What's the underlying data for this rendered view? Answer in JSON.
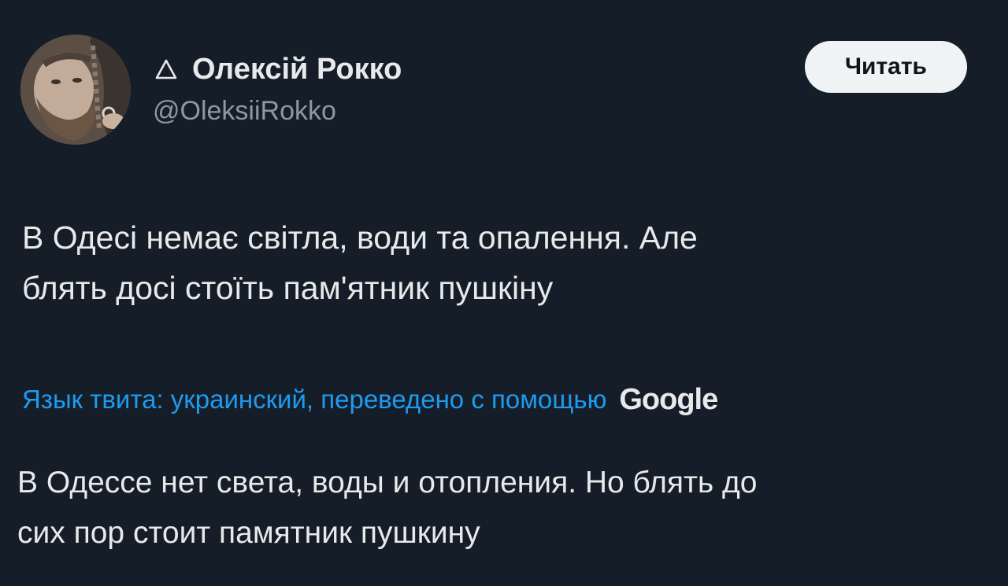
{
  "author": {
    "name": "Олексій Рокко",
    "handle": "@OleksiiRokko",
    "badge_icon": "triangle-outline-icon"
  },
  "follow_button": {
    "label": "Читать"
  },
  "tweet": {
    "lines": [
      "В Одесі немає світла, води та опалення. Але",
      "блять досі стоїть пам'ятник пушкіну"
    ]
  },
  "translation": {
    "notice": "Язык твита: украинский, переведено с помощью",
    "provider": "Google",
    "lines": [
      "В Одессе нет света, воды и отопления. Но блять до",
      "сих пор стоит памятник пушкину"
    ]
  },
  "colors": {
    "background": "#151d28",
    "text": "#e7e9ea",
    "muted": "#8b98a5",
    "link": "#1d9bf0",
    "button_bg": "#eff3f4"
  }
}
